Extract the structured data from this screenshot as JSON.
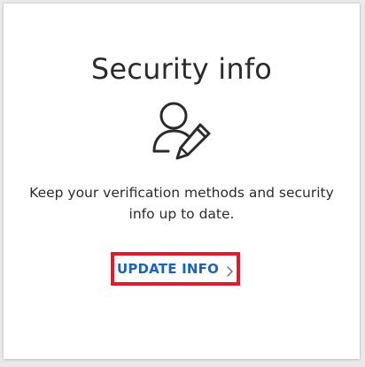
{
  "card": {
    "title": "Security info",
    "icon": "user-edit-icon",
    "description": "Keep your verification methods and security info up to date.",
    "link_label": "UPDATE INFO",
    "link_icon": "chevron-right-icon",
    "link_color": "#1b63b8",
    "highlight_color": "#e11b2b"
  }
}
